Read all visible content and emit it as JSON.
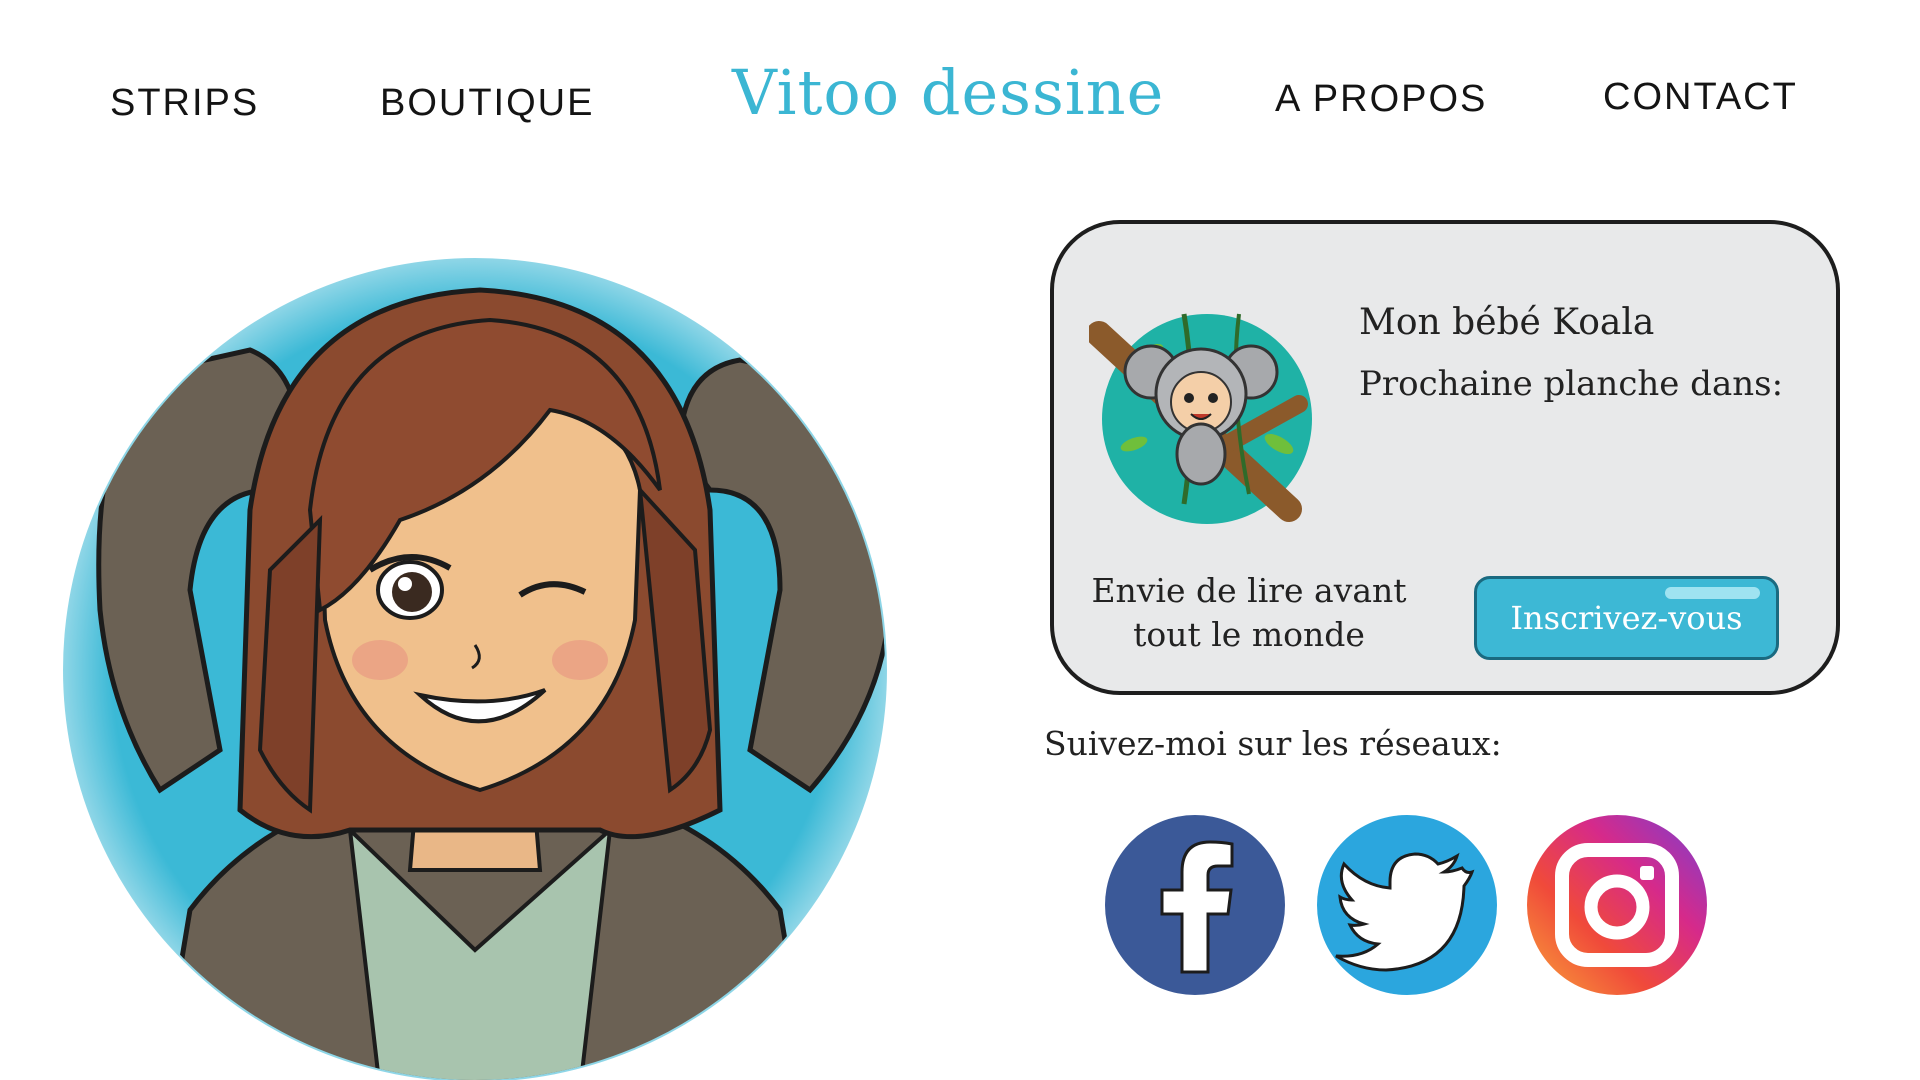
{
  "nav": {
    "left": [
      "STRIPS",
      "BOUTIQUE"
    ],
    "right": [
      "A PROPOS",
      "CONTACT"
    ],
    "brand": "Vitoo dessine"
  },
  "card": {
    "title": "Mon bébé Koala",
    "countdown_label": "Prochaine planche dans:",
    "cta_line1": "Envie de lire avant",
    "cta_line2": "tout le monde",
    "button_label": "Inscrivez-vous"
  },
  "social": {
    "heading": "Suivez-moi sur les réseaux:",
    "networks": [
      "facebook-icon",
      "twitter-icon",
      "instagram-icon"
    ]
  },
  "colors": {
    "accent": "#3bb6d3",
    "card_bg": "#e8e9ea",
    "facebook": "#3b5998",
    "twitter": "#2ba6de",
    "button": "#3db8d5"
  }
}
